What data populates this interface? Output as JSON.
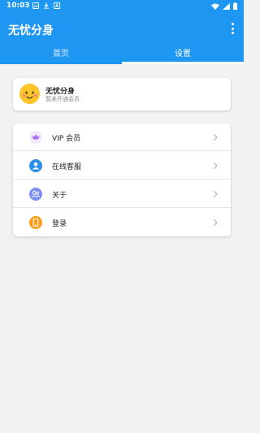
{
  "status_bar": {
    "time": "10:03"
  },
  "app": {
    "title": "无忧分身"
  },
  "tabs": [
    {
      "label": "首页",
      "active": false
    },
    {
      "label": "设置",
      "active": true
    }
  ],
  "profile": {
    "name": "无忧分身",
    "subtitle": "暂未开通会员"
  },
  "menu": {
    "items": [
      {
        "label": "VIP 会员",
        "icon": "vip-icon"
      },
      {
        "label": "在线客服",
        "icon": "customer-service-icon"
      },
      {
        "label": "关于",
        "icon": "about-icon"
      },
      {
        "label": "登录",
        "icon": "login-icon"
      }
    ]
  },
  "colors": {
    "brand": "#1e97f3",
    "background": "#f2f2f2",
    "vip": "#a86ff0",
    "service": "#2a8fe8",
    "about": "#7b8df5",
    "login": "#ff9d1a",
    "avatar": "#fbc52b"
  }
}
